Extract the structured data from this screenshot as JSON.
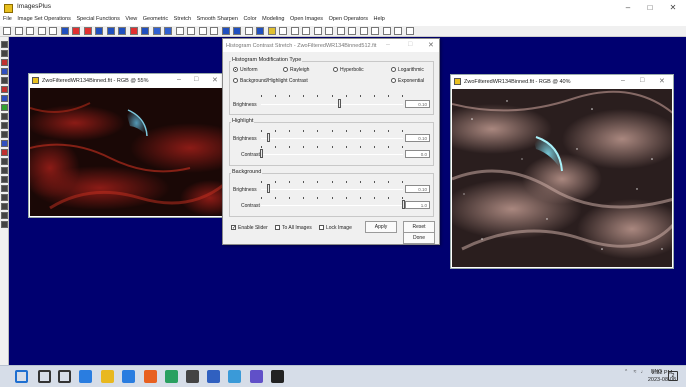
{
  "app": {
    "title": "ImagesPlus"
  },
  "menu": [
    "File",
    "Image Set Operations",
    "Special Functions",
    "View",
    "Geometric",
    "Stretch",
    "Smooth Sharpen",
    "Color",
    "Modeling",
    "Open Images",
    "Open Operators",
    "Help"
  ],
  "toolbar_icons": [
    "new-icon",
    "open-icon",
    "save-icon",
    "close-icon",
    "close-icon",
    "layers-icon",
    "color-bars-icon",
    "red-square-icon",
    "blue-square-icon",
    "arrow-left-icon",
    "arrow-right-icon",
    "arrow-left-icon",
    "arrow-right-icon",
    "filter-icon",
    "filter-icon",
    "line-icon",
    "crop-icon",
    "chart-icon",
    "rotate-icon",
    "plus-icon",
    "plus-icon",
    "grid-icon",
    "image-icon",
    "paint-icon",
    "zoom-in-icon",
    "zoom-out-icon",
    "zoom-icon",
    "zoom-fit-icon",
    "frame-icon",
    "frame-icon",
    "frame-icon",
    "frame-icon",
    "frame-icon",
    "window-icon",
    "close-icon",
    "tile-icon"
  ],
  "left_tools": [
    "move-icon",
    "select-icon",
    "crop-icon",
    "brush-icon",
    "eraser-icon",
    "red-icon",
    "blue-icon",
    "green-icon",
    "text-icon",
    "pen-icon",
    "star-icon",
    "plus-icon",
    "color-icon",
    "zoom-icon",
    "grid-icon",
    "hand-icon",
    "text-icon",
    "rotate-icon",
    "measure-icon",
    "chart-icon",
    "layer-icon"
  ],
  "left_image_window": {
    "title": "ZwoFilteredWR134Binned.fit - RGB @ 55%"
  },
  "right_image_window": {
    "title": "ZwoFilteredWR134Binned.fit - RGB @ 40%"
  },
  "dialog": {
    "title": "Histogram Contrast Stretch - ZwoFilteredWR134Binned512.fit",
    "modification_group": {
      "label": "Histogram Modification Type",
      "options": {
        "uniform": "Uniform",
        "rayleigh": "Rayleigh",
        "hyperbolic": "Hyperbolic",
        "logarithmic": "Logarithmic",
        "bg_highlight": "Background/Highlight Contrast",
        "exponential": "Exponential"
      },
      "selected": "Uniform",
      "brightness_label": "Brightness",
      "brightness_value": "0.10",
      "brightness_level": 0.55
    },
    "highlight_group": {
      "label": "Highlight",
      "brightness_label": "Brightness",
      "brightness_value": "0.10",
      "brightness_level": 0.05,
      "contrast_label": "Contrast",
      "contrast_value": "0.0",
      "contrast_level": 0.0
    },
    "background_group": {
      "label": "Background",
      "brightness_label": "Brightness",
      "brightness_value": "0.10",
      "brightness_level": 0.05,
      "contrast_label": "Contrast",
      "contrast_value": "1.0",
      "contrast_level": 1.0
    },
    "enable_slider": {
      "label": "Enable Slider",
      "checked": true
    },
    "to_all_images": {
      "label": "To All Images",
      "checked": false
    },
    "lock_image": {
      "label": "Lock Image",
      "checked": false
    },
    "apply_label": "Apply",
    "reset_label": "Reset",
    "done_label": "Done"
  },
  "taskbar": {
    "apps": [
      "windows-start-icon",
      "search-icon",
      "task-view-icon",
      "widgets-icon",
      "explorer-icon",
      "store-icon",
      "firefox-icon",
      "chrome-icon",
      "app-icon",
      "app-icon",
      "app-icon",
      "app-icon",
      "imagesplus-icon"
    ],
    "tray": {
      "lang": "ENG"
    },
    "clock": {
      "time": "2:32 PM",
      "date": "2023-08-08"
    },
    "notification_count": "2"
  },
  "colors": {
    "mdi_background": "#000070",
    "title_background": "#ffffff"
  }
}
